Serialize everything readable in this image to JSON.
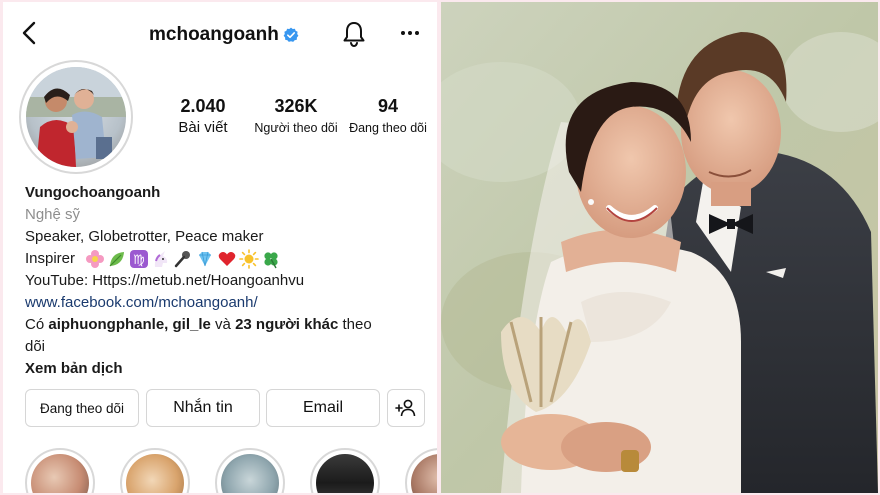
{
  "profile": {
    "username": "mchoangoanh",
    "stats": {
      "posts_value": "2.040",
      "posts_label": "Bài viết",
      "followers_value": "326K",
      "followers_label": "Người theo dõi",
      "following_value": "94",
      "following_label": "Đang theo dõi"
    },
    "bio": {
      "name": "Vungochoangoanh",
      "category": "Nghệ sỹ",
      "line1": "Speaker, Globetrotter, Peace maker",
      "line2": "Inspirer",
      "line3": "YouTube: Https://metub.net/Hoangoanhvu",
      "website": "www.facebook.com/mchoangoanh/",
      "followed_by_prefix": "Có",
      "followed_by_users": "aiphuongphanle, gil_le",
      "followed_by_and": "và",
      "followed_by_others": "23 người khác",
      "followed_by_suffix": "theo",
      "followed_by_suffix2": "dõi",
      "translate": "Xem bản dịch",
      "emojis": [
        "flower-emoji",
        "leaf-emoji",
        "virgo-emoji",
        "unicorn-emoji",
        "microphone-emoji",
        "gem-emoji",
        "heart-emoji",
        "sun-emoji",
        "clover-emoji"
      ]
    },
    "buttons": {
      "following": "Đang theo dõi",
      "message": "Nhắn tin",
      "email": "Email"
    }
  },
  "colors": {
    "verified": "#3897f0",
    "link": "#1a3a6e",
    "muted": "#8e8e8e",
    "border": "#d6d6d6",
    "frame": "#fbe9ee"
  }
}
